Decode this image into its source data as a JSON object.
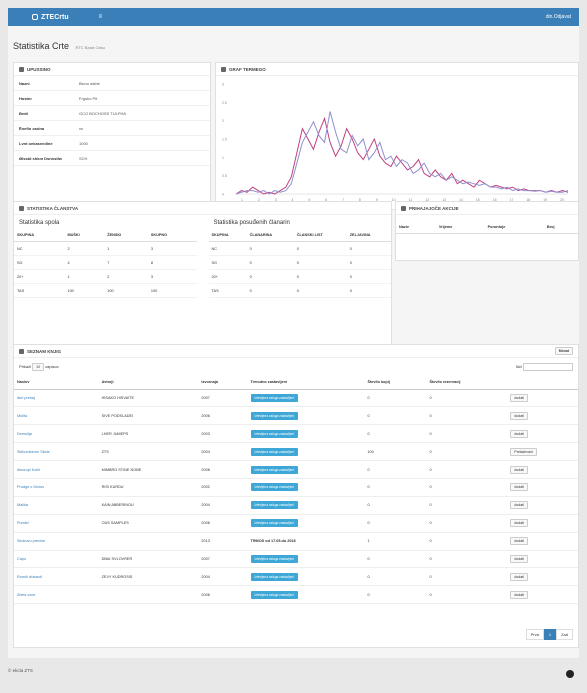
{
  "topbar": {
    "brand": "ZTECrtu",
    "menu_icon": "≡",
    "user": "din.Odjavat"
  },
  "page": {
    "title": "Statistika Crte",
    "subtitle": "RTC  Barat Odso"
  },
  "info": {
    "title": "UPUSSINO",
    "rows": [
      {
        "k": "Nazni",
        "v": "Bicno asthe"
      },
      {
        "k": "Hostnr",
        "v": "Frgsho Pit"
      },
      {
        "k": "Bedt",
        "v": "GCO BOCHOSS TULPHA"
      },
      {
        "k": "Ëneflo osdna",
        "v": "vs"
      },
      {
        "k": "Lvnt oekaseedlne",
        "v": "1000"
      },
      {
        "k": "Ølsstd shkm Dsnnstlw",
        "v": "SCH"
      }
    ]
  },
  "graph": {
    "title": "GRAF TERMEGO",
    "y_ticks": [
      "3",
      "2.5",
      "2",
      "1.5",
      "1",
      "0.5",
      "0"
    ],
    "x_ticks": [
      "1",
      "2",
      "3",
      "4",
      "5",
      "6",
      "7",
      "8",
      "9",
      "10",
      "11",
      "12",
      "13",
      "14",
      "15",
      "16",
      "17",
      "18",
      "19",
      "20"
    ]
  },
  "chart_data": {
    "type": "line",
    "x": [
      0,
      1,
      2,
      3,
      4,
      5,
      6,
      7,
      8,
      9,
      10,
      11,
      12,
      13,
      14,
      15,
      16,
      17,
      18,
      19,
      20,
      21,
      22,
      23,
      24,
      25,
      26,
      27,
      28,
      29,
      30,
      31,
      32,
      33,
      34,
      35,
      36,
      37,
      38,
      39,
      40,
      41,
      42,
      43,
      44,
      45,
      46,
      47,
      48,
      49,
      50,
      51,
      52,
      53,
      54,
      55,
      56,
      57,
      58,
      59,
      60
    ],
    "ylim": [
      0,
      3.2
    ],
    "series": [
      {
        "name": "",
        "color": "#c04080",
        "values": [
          0,
          0.1,
          0.05,
          0.2,
          0.1,
          0,
          0.05,
          0,
          0.1,
          0.2,
          0.5,
          1.2,
          1.9,
          1.6,
          1.3,
          1.8,
          2.2,
          1.5,
          1.1,
          1.4,
          1.9,
          1.6,
          1.2,
          1.0,
          1.3,
          1.6,
          1.1,
          0.9,
          0.8,
          1.1,
          0.9,
          0.7,
          0.8,
          1.0,
          0.6,
          0.5,
          0.7,
          0.5,
          0.4,
          0.6,
          0.3,
          0.4,
          0.3,
          0.2,
          0.4,
          0.3,
          0.2,
          0.25,
          0.2,
          0.15,
          0.2,
          0.1,
          0.15,
          0.1,
          0.1,
          0.1,
          0.05,
          0.1,
          0.05,
          0.1,
          0.05
        ]
      },
      {
        "name": "",
        "color": "#9090d0",
        "values": [
          0,
          0.05,
          0.1,
          0.1,
          0.05,
          0.1,
          0,
          0.1,
          0.05,
          0.1,
          0.3,
          0.9,
          1.5,
          1.8,
          2.1,
          1.7,
          1.5,
          2.4,
          1.8,
          1.3,
          1.2,
          1.7,
          1.4,
          1.6,
          1.0,
          1.2,
          1.5,
          1.0,
          1.1,
          0.8,
          1.0,
          0.9,
          0.6,
          0.7,
          0.9,
          0.6,
          0.5,
          0.6,
          0.4,
          0.5,
          0.4,
          0.3,
          0.35,
          0.3,
          0.25,
          0.3,
          0.2,
          0.2,
          0.15,
          0.2,
          0.1,
          0.15,
          0.1,
          0.1,
          0.08,
          0.1,
          0.05,
          0.08,
          0.05,
          0.05,
          0.1
        ]
      }
    ]
  },
  "stats": {
    "title": "STATISTIKA ČLANSTVA",
    "left_title": "Statistika spola",
    "right_title": "Statistika posuđenih članarin",
    "left_headers": [
      "SKUPINA",
      "MUŠKI",
      "ŽENSKI",
      "SKUPNO"
    ],
    "left_rows": [
      [
        "NC",
        "2",
        "1",
        "3"
      ],
      [
        "SG",
        "4",
        "7",
        "8"
      ],
      [
        "20+",
        "1",
        "2",
        "3"
      ],
      [
        "TAS",
        "100",
        "100",
        "100"
      ]
    ],
    "right_headers": [
      "SKUPINA",
      "ČLANARINA",
      "ČLANSKI LIST",
      "ZELJAVINA"
    ],
    "right_rows": [
      [
        "NC",
        "0",
        "0",
        "0"
      ],
      [
        "SG",
        "0",
        "0",
        "0"
      ],
      [
        "20+",
        "0",
        "0",
        "0"
      ],
      [
        "TAS",
        "0",
        "0",
        "0"
      ]
    ]
  },
  "actions": {
    "title": "PRIHAJAJOČE AKCIJE",
    "headers": [
      "Naziv",
      "Vrijeme",
      "Poruntoje",
      "Broj"
    ]
  },
  "books": {
    "title": "SEZNAM KNJIG",
    "export_label": "Monat",
    "show_label": "Prikaži",
    "show_value": "10",
    "show_suffix": "zapisov",
    "search_label": "Išči",
    "headers": [
      "Naslov",
      "Avtorji",
      "Izvornaja",
      "Trenutno zastavljeni",
      "Število kopij",
      "Število rezervacij",
      ""
    ],
    "rows": [
      {
        "title": "Iteri prešaj",
        "author": "HISAKO HISVAITE",
        "year": "2007",
        "status": "Iztevljena zaloga zastavljeni",
        "copies": "0",
        "res": "0",
        "action": "dodati"
      },
      {
        "title": "Molita",
        "author": "SIVE PODSLADEI",
        "year": "2006",
        "status": "Iztevljena zaloga zastavljeni",
        "copies": "0",
        "res": "0",
        "action": "dodati"
      },
      {
        "title": "Demolija",
        "author": "LHER JUMEPS",
        "year": "2003",
        "status": "Iztevljena zaloga zastavljeni",
        "copies": "0",
        "res": "0",
        "action": "dodati"
      },
      {
        "title": "Skihumbeum Skide",
        "author": "ZTS",
        "year": "2004",
        "status": "Iztevljena zaloga zastavljeni",
        "copies": "100",
        "res": "0",
        "action": "Prelazhvani"
      },
      {
        "title": "Alecrupi Kokil",
        "author": "MIMBRO STINE NOBE",
        "year": "2008",
        "status": "Iztevljena zaloga zastavljeni",
        "copies": "0",
        "res": "0",
        "action": "dodati"
      },
      {
        "title": "Prudge o Moros",
        "author": "RISI KURDU",
        "year": "2002",
        "status": "Iztevljena zaloga zastavljeni",
        "copies": "0",
        "res": "0",
        "action": "dodati"
      },
      {
        "title": "Malika",
        "author": "KAIN ABBERINOU",
        "year": "2004",
        "status": "Iztevljena zaloga zastavljeni",
        "copies": "0",
        "res": "0",
        "action": "dodati"
      },
      {
        "title": "Pomlid",
        "author": "OUS SAMPLES",
        "year": "2006",
        "status": "Iztevljena zaloga zastavljeni",
        "copies": "0",
        "res": "0",
        "action": "dodati"
      },
      {
        "title": "Skokovo previne",
        "author": "",
        "year": "2013",
        "status": "TRMOS od 17.05.do 2018",
        "copies": "1",
        "res": "0",
        "action": "dodati"
      },
      {
        "title": "Capo",
        "author": "DBAI SVLOVRER",
        "year": "2007",
        "status": "Iztevljena zaloga zastavljeni",
        "copies": "0",
        "res": "0",
        "action": "dodati"
      },
      {
        "title": "Romiti dvisanit",
        "author": "ZEVY KUDROSIS",
        "year": "2004",
        "status": "Iztevljena zaloga zastavljeni",
        "copies": "0",
        "res": "0",
        "action": "dodati"
      },
      {
        "title": "Zbeis ccne",
        "author": "",
        "year": "2006",
        "status": "Iztevljena zaloga zastavljeni",
        "copies": "0",
        "res": "0",
        "action": "dodati"
      }
    ],
    "pagination": {
      "prev": "Prvá",
      "current": "1",
      "next": "Zad"
    }
  },
  "footer": {
    "text": "© ekcla ZTS"
  }
}
